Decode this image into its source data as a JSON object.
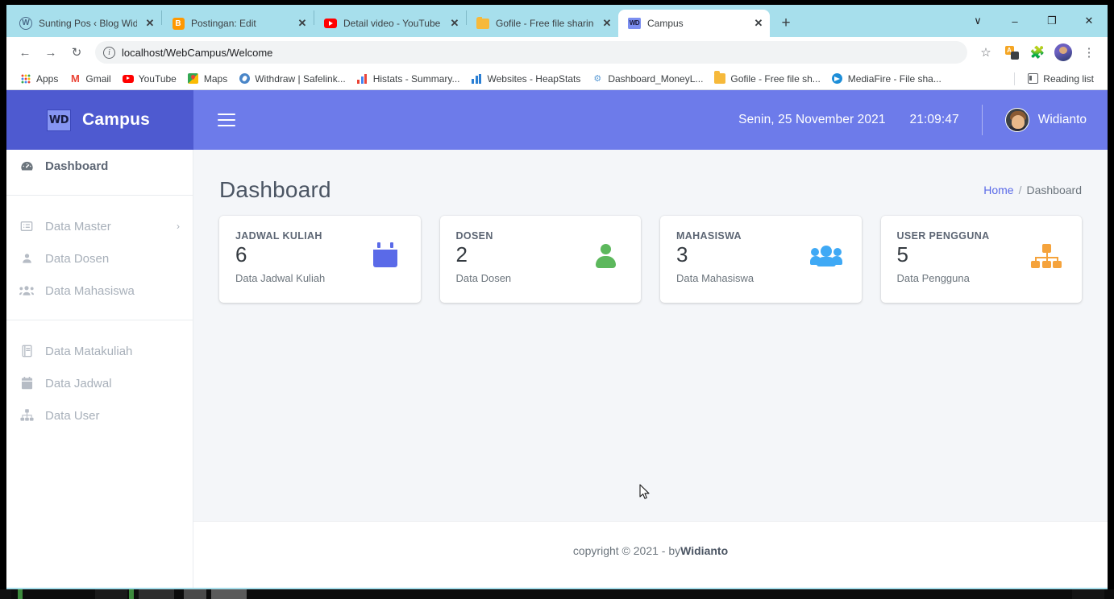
{
  "browser": {
    "tabs": [
      {
        "title": "Sunting Pos ‹ Blog Widianto -",
        "icon": "wordpress-icon",
        "active": false
      },
      {
        "title": "Postingan: Edit",
        "icon": "blogger-icon",
        "active": false
      },
      {
        "title": "Detail video - YouTube Studio",
        "icon": "youtube-icon",
        "active": false
      },
      {
        "title": "Gofile - Free file sharing and",
        "icon": "gofile-icon",
        "active": false
      },
      {
        "title": "Campus",
        "icon": "wd-campus-icon",
        "active": true
      }
    ],
    "new_tab_label": "+",
    "window_controls": {
      "minimize": "–",
      "maximize": "❐",
      "close": "✕",
      "more": "∨"
    },
    "toolbar": {
      "back": "←",
      "forward": "→",
      "reload": "↻",
      "url": "localhost/WebCampus/Welcome",
      "star_label": "☆",
      "menu_label": "⋮"
    },
    "bookmarks": [
      {
        "label": "Apps",
        "icon": "apps-grid-icon"
      },
      {
        "label": "Gmail",
        "icon": "gmail-icon"
      },
      {
        "label": "YouTube",
        "icon": "youtube-icon"
      },
      {
        "label": "Maps",
        "icon": "maps-icon"
      },
      {
        "label": "Withdraw | Safelink...",
        "icon": "safelink-icon"
      },
      {
        "label": "Histats - Summary...",
        "icon": "histats-icon"
      },
      {
        "label": "Websites - HeapStats",
        "icon": "heapstats-icon"
      },
      {
        "label": "Dashboard_MoneyL...",
        "icon": "moneylink-icon"
      },
      {
        "label": "Gofile - Free file sh...",
        "icon": "gofile-icon"
      },
      {
        "label": "MediaFire - File sha...",
        "icon": "mediafire-icon"
      }
    ],
    "reading_list": "Reading list"
  },
  "app": {
    "brand": {
      "logo_text": "WD",
      "name": "Campus"
    },
    "navbar": {
      "menu_toggle": "hamburger-icon",
      "date": "Senin, 25 November 2021",
      "time": "21:09:47",
      "username": "Widianto"
    },
    "sidebar": {
      "items": [
        {
          "label": "Dashboard",
          "icon": "tachometer-icon",
          "active": true,
          "chevron": null
        },
        {
          "label": "Data Master",
          "icon": "list-alt-icon",
          "active": false,
          "chevron": "›"
        },
        {
          "label": "Data Dosen",
          "icon": "user-icon",
          "active": false,
          "chevron": null
        },
        {
          "label": "Data Mahasiswa",
          "icon": "users-icon",
          "active": false,
          "chevron": null
        },
        {
          "label": "Data Matakuliah",
          "icon": "book-icon",
          "active": false,
          "chevron": null
        },
        {
          "label": "Data Jadwal",
          "icon": "calendar-icon",
          "active": false,
          "chevron": null
        },
        {
          "label": "Data User",
          "icon": "sitemap-icon",
          "active": false,
          "chevron": null
        }
      ]
    },
    "page": {
      "title": "Dashboard",
      "breadcrumb": {
        "home": "Home",
        "separator": "/",
        "current": "Dashboard"
      },
      "cards": [
        {
          "label": "JADWAL KULIAH",
          "value": "6",
          "sub": "Data Jadwal Kuliah",
          "icon": "calendar-icon",
          "color": "#5a6ae8"
        },
        {
          "label": "DOSEN",
          "value": "2",
          "sub": "Data Dosen",
          "icon": "user-icon",
          "color": "#5cb85c"
        },
        {
          "label": "MAHASISWA",
          "value": "3",
          "sub": "Data Mahasiswa",
          "icon": "users-icon",
          "color": "#3fa9f5"
        },
        {
          "label": "USER PENGGUNA",
          "value": "5",
          "sub": "Data Pengguna",
          "icon": "sitemap-icon",
          "color": "#f5a33c"
        }
      ]
    },
    "footer": {
      "text": "copyright © 2021 - by ",
      "author": "Widianto"
    }
  },
  "colors": {
    "brand_dark": "#4e5ad0",
    "navbar": "#6d7bea",
    "content_bg": "#f4f6f9",
    "link": "#5a6ae8"
  }
}
